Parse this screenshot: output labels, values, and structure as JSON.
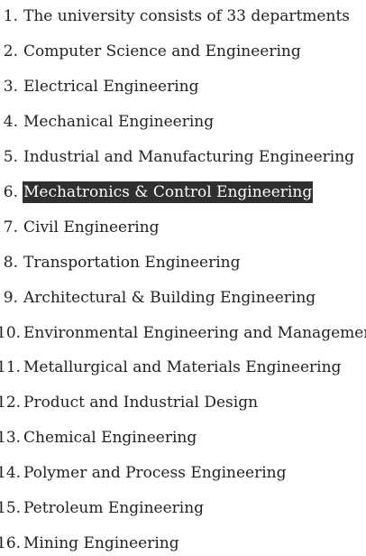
{
  "list": {
    "items": [
      {
        "number": "1.",
        "label": "The university consists of 33 departments",
        "selected": false
      },
      {
        "number": "2.",
        "label": "Computer Science and Engineering",
        "selected": false
      },
      {
        "number": "3.",
        "label": "Electrical Engineering",
        "selected": false
      },
      {
        "number": "4.",
        "label": "Mechanical Engineering",
        "selected": false
      },
      {
        "number": "5.",
        "label": "Industrial and Manufacturing Engineering",
        "selected": false
      },
      {
        "number": "6.",
        "label": "Mechatronics & Control Engineering",
        "selected": true
      },
      {
        "number": "7.",
        "label": "Civil Engineering",
        "selected": false
      },
      {
        "number": "8.",
        "label": "Transportation Engineering",
        "selected": false
      },
      {
        "number": "9.",
        "label": "Architectural & Building Engineering",
        "selected": false
      },
      {
        "number": "10.",
        "label": "Environmental Engineering and Management",
        "selected": false
      },
      {
        "number": "11.",
        "label": "Metallurgical and Materials Engineering",
        "selected": false
      },
      {
        "number": "12.",
        "label": "Product and Industrial Design",
        "selected": false
      },
      {
        "number": "13.",
        "label": "Chemical Engineering",
        "selected": false
      },
      {
        "number": "14.",
        "label": "Polymer and Process Engineering",
        "selected": false
      },
      {
        "number": "15.",
        "label": "Petroleum Engineering",
        "selected": false
      },
      {
        "number": "16.",
        "label": "Mining Engineering",
        "selected": false
      }
    ]
  },
  "colors": {
    "text": "#222222",
    "selection_background": "#2f2f2f",
    "selection_text": "#ffffff"
  }
}
